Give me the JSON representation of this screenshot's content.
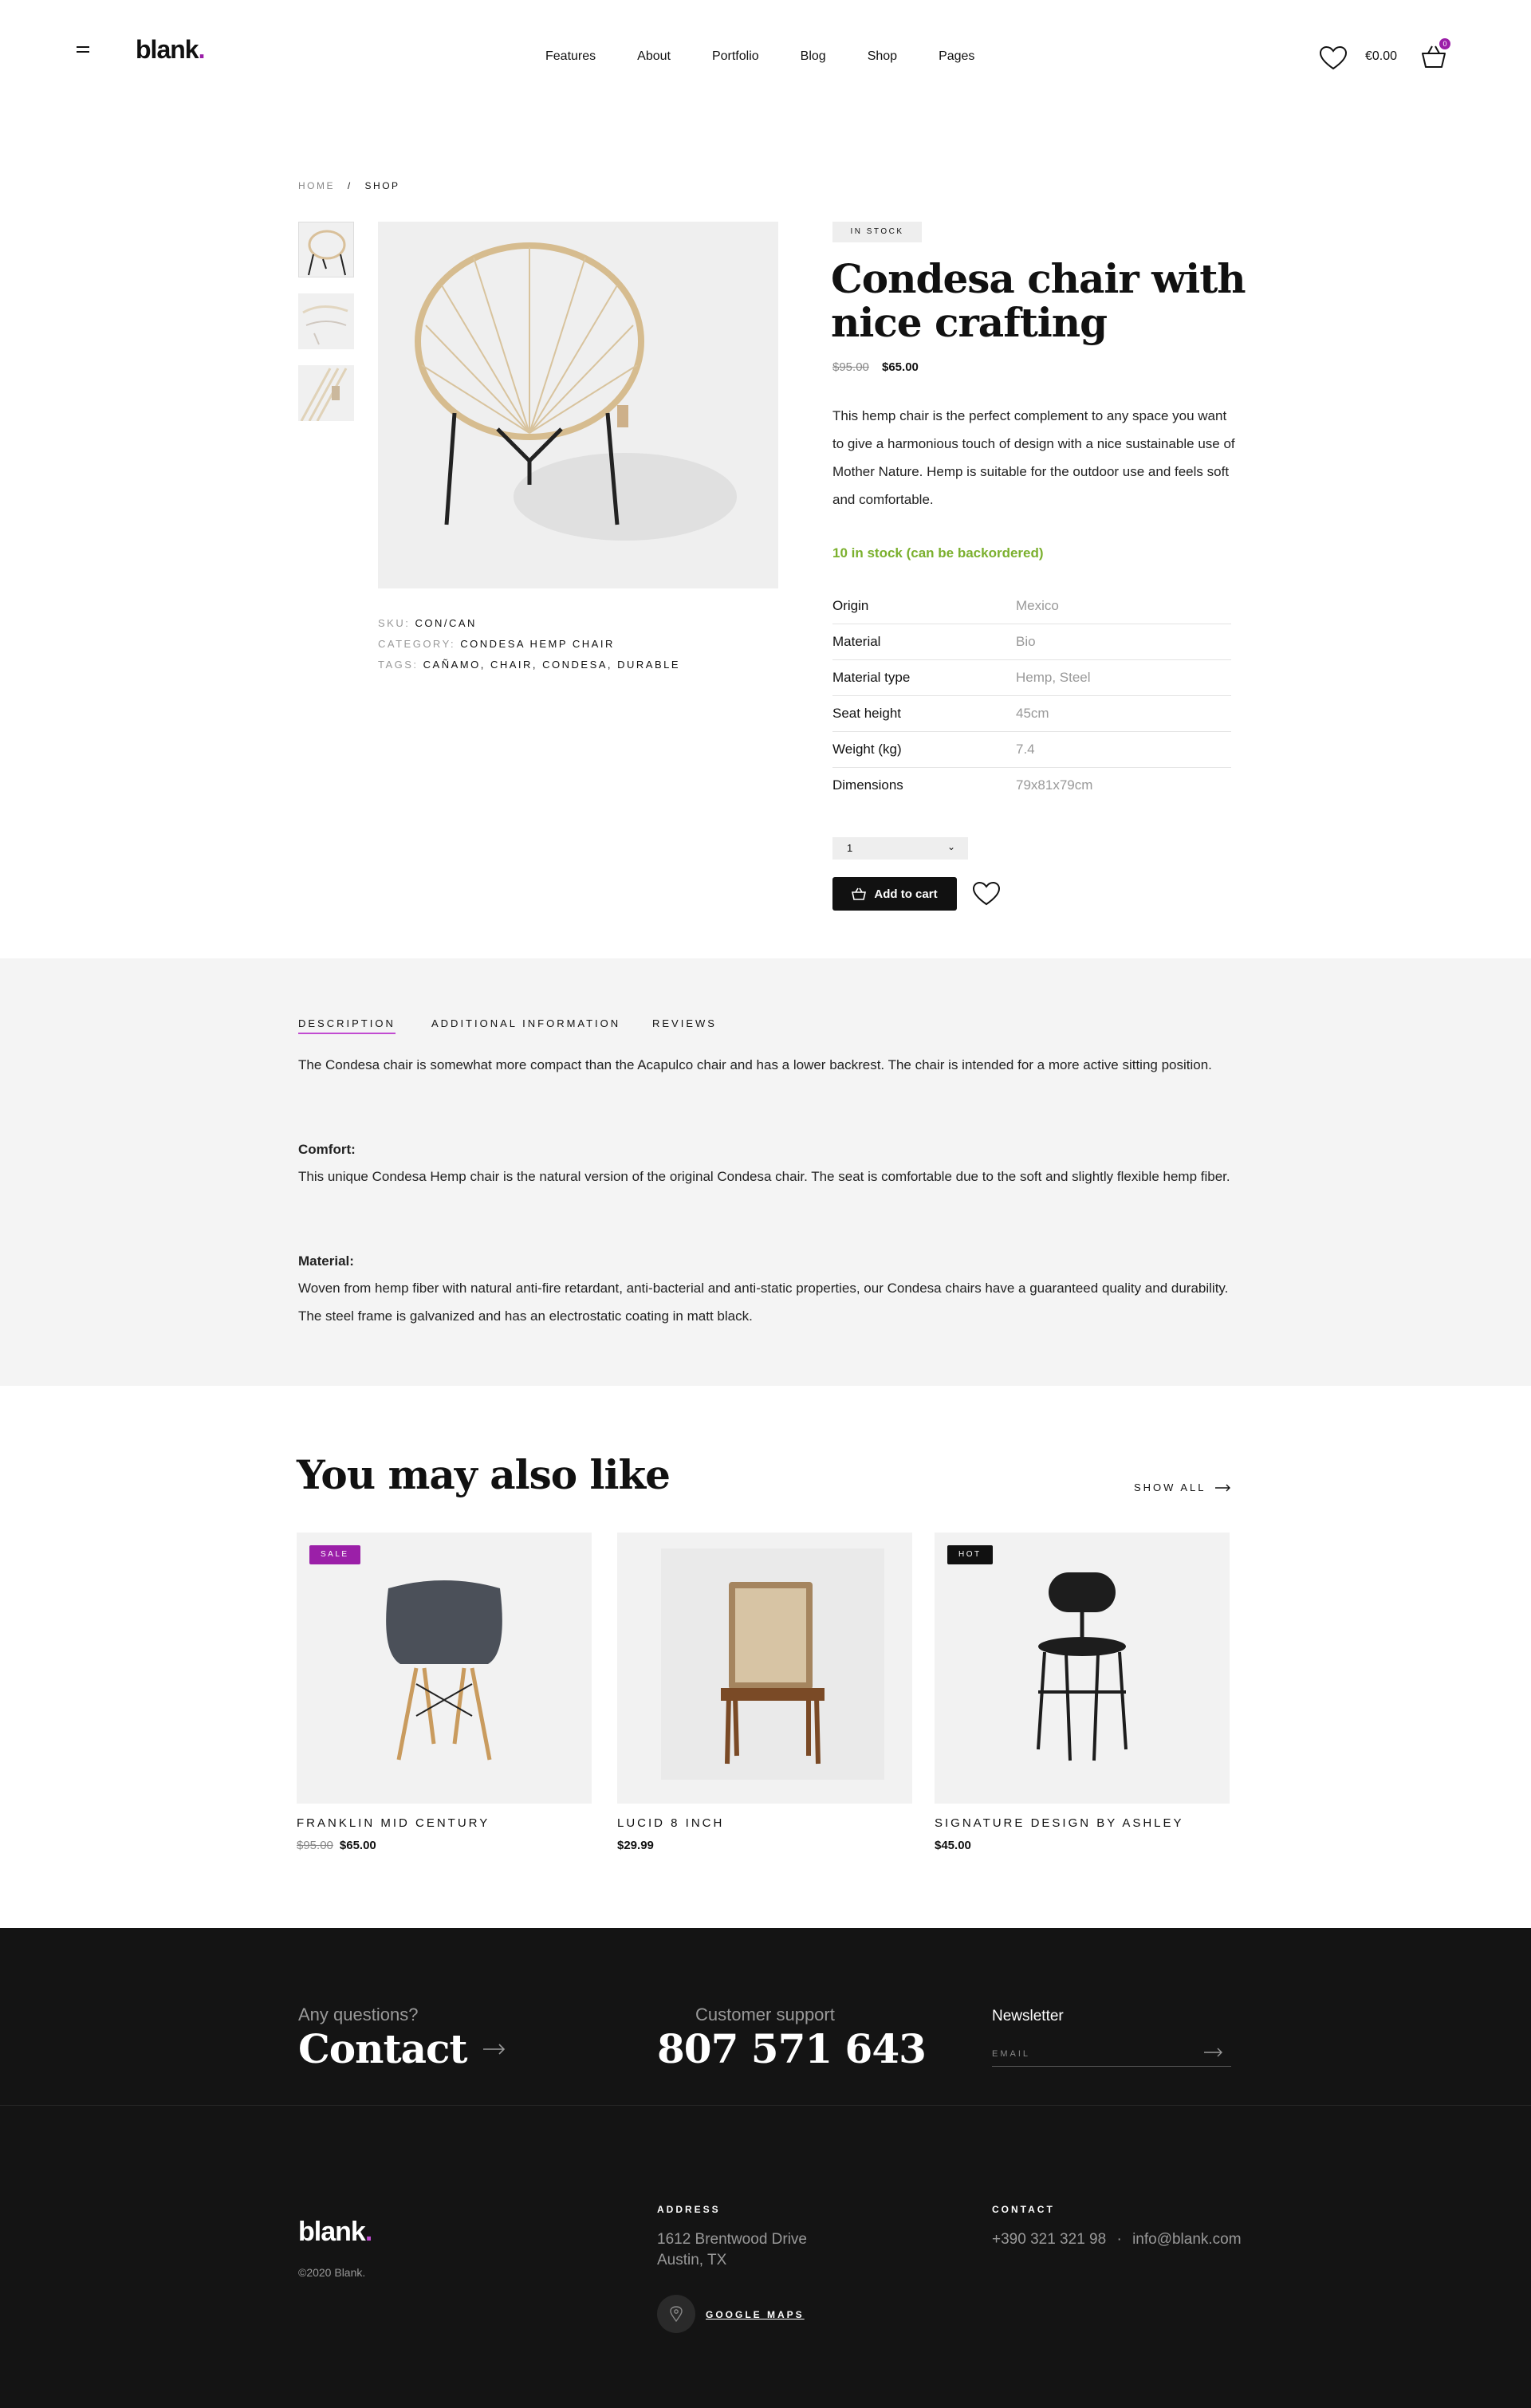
{
  "header": {
    "logo": "blank",
    "logo_dot": ".",
    "nav": [
      "Features",
      "About",
      "Portfolio",
      "Blog",
      "Shop",
      "Pages"
    ],
    "cart_total": "€0.00",
    "cart_count": "0"
  },
  "breadcrumb": {
    "home": "HOME",
    "sep": "/",
    "current": "SHOP"
  },
  "product": {
    "stock_badge": "IN STOCK",
    "title": "Condesa chair with nice crafting",
    "price_old": "$95.00",
    "price_new": "$65.00",
    "description": "This hemp chair is the perfect complement to any space you want to give a harmonious touch of design with a nice sustainable use of Mother Nature. Hemp is suitable for the outdoor use and feels soft and comfortable.",
    "stock_text": "10 in stock (can be backordered)",
    "specs": [
      {
        "label": "Origin",
        "value": "Mexico"
      },
      {
        "label": "Material",
        "value": "Bio"
      },
      {
        "label": "Material type",
        "value": "Hemp, Steel"
      },
      {
        "label": "Seat height",
        "value": "45cm"
      },
      {
        "label": "Weight (kg)",
        "value": "7.4"
      },
      {
        "label": "Dimensions",
        "value": "79x81x79cm"
      }
    ],
    "quantity": "1",
    "add_to_cart": "Add to cart",
    "sku_label": "SKU:",
    "sku": "CON/CAN",
    "category_label": "CATEGORY:",
    "category": "CONDESA HEMP CHAIR",
    "tags_label": "TAGS:",
    "tags": "CAÑAMO, CHAIR, CONDESA, DURABLE"
  },
  "tabs": {
    "items": [
      "DESCRIPTION",
      "ADDITIONAL INFORMATION",
      "REVIEWS"
    ],
    "intro": "The Condesa chair is somewhat more compact than the Acapulco chair and has a lower backrest. The chair is intended for a more active sitting position.",
    "comfort_title": "Comfort:",
    "comfort_text": "This unique Condesa Hemp chair is the natural version of the original Condesa chair. The seat is comfortable due to the soft and slightly flexible hemp fiber.",
    "material_title": "Material:",
    "material_text": "Woven from hemp fiber with natural anti-fire retardant, anti-bacterial and anti-static properties, our Condesa chairs have a guaranteed quality and durability. The steel frame is galvanized and has an electrostatic coating in matt black."
  },
  "related": {
    "title": "You may also like",
    "show_all": "SHOW ALL",
    "items": [
      {
        "name": "FRANKLIN MID CENTURY",
        "price_old": "$95.00",
        "price": "$65.00",
        "badge": "SALE"
      },
      {
        "name": "LUCID 8 INCH",
        "price": "$29.99"
      },
      {
        "name": "SIGNATURE DESIGN BY ASHLEY",
        "price": "$45.00",
        "badge": "HOT"
      }
    ]
  },
  "footer": {
    "questions": "Any questions?",
    "contact": "Contact",
    "support_label": "Customer support",
    "phone": "807 571 643",
    "newsletter": "Newsletter",
    "email_placeholder": "EMAIL",
    "logo": "blank",
    "logo_dot": ".",
    "copyright": "©2020 Blank.",
    "address_heading": "ADDRESS",
    "address_line1": "1612  Brentwood Drive",
    "address_line2": "Austin, TX",
    "maps_link": "GOOGLE MAPS",
    "contact_heading": "CONTACT",
    "contact_phone": "+390 321 321 98",
    "contact_sep": "·",
    "contact_email": "info@blank.com"
  },
  "colors": {
    "accent": "#9b1fa8",
    "stock_green": "#7bb02e",
    "footer_bg": "#141414"
  }
}
